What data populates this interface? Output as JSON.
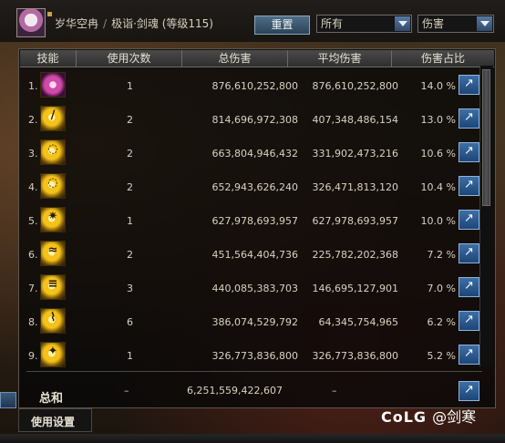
{
  "header": {
    "server": "岁华空冉",
    "separator": "/",
    "character": "极诣·剑魂",
    "level_text": "(等级115)",
    "reset_label": "重置",
    "filter_select": "所有",
    "metric_select": "伤害"
  },
  "table": {
    "columns": [
      "技能",
      "使用次数",
      "总伤害",
      "平均伤害",
      "伤害占比"
    ],
    "rows": [
      {
        "index": "1.",
        "uses": "1",
        "total": "876,610,252,800",
        "average": "876,610,252,800",
        "percent": "14.0 %"
      },
      {
        "index": "2.",
        "uses": "2",
        "total": "814,696,972,308",
        "average": "407,348,486,154",
        "percent": "13.0 %"
      },
      {
        "index": "3.",
        "uses": "2",
        "total": "663,804,946,432",
        "average": "331,902,473,216",
        "percent": "10.6 %"
      },
      {
        "index": "4.",
        "uses": "2",
        "total": "652,943,626,240",
        "average": "326,471,813,120",
        "percent": "10.4 %"
      },
      {
        "index": "5.",
        "uses": "1",
        "total": "627,978,693,957",
        "average": "627,978,693,957",
        "percent": "10.0 %"
      },
      {
        "index": "6.",
        "uses": "2",
        "total": "451,564,404,736",
        "average": "225,782,202,368",
        "percent": "7.2 %"
      },
      {
        "index": "7.",
        "uses": "3",
        "total": "440,085,383,703",
        "average": "146,695,127,901",
        "percent": "7.0 %"
      },
      {
        "index": "8.",
        "uses": "6",
        "total": "386,074,529,792",
        "average": "64,345,754,965",
        "percent": "6.2 %"
      },
      {
        "index": "9.",
        "uses": "1",
        "total": "326,773,836,800",
        "average": "326,773,836,800",
        "percent": "5.2 %"
      }
    ],
    "summary": {
      "label": "总和",
      "uses": "–",
      "total": "6,251,559,422,607",
      "average": "–"
    }
  },
  "footer": {
    "settings_label": "使用设置"
  },
  "watermark": {
    "logo": "CoLG",
    "text": "@剑寒"
  }
}
